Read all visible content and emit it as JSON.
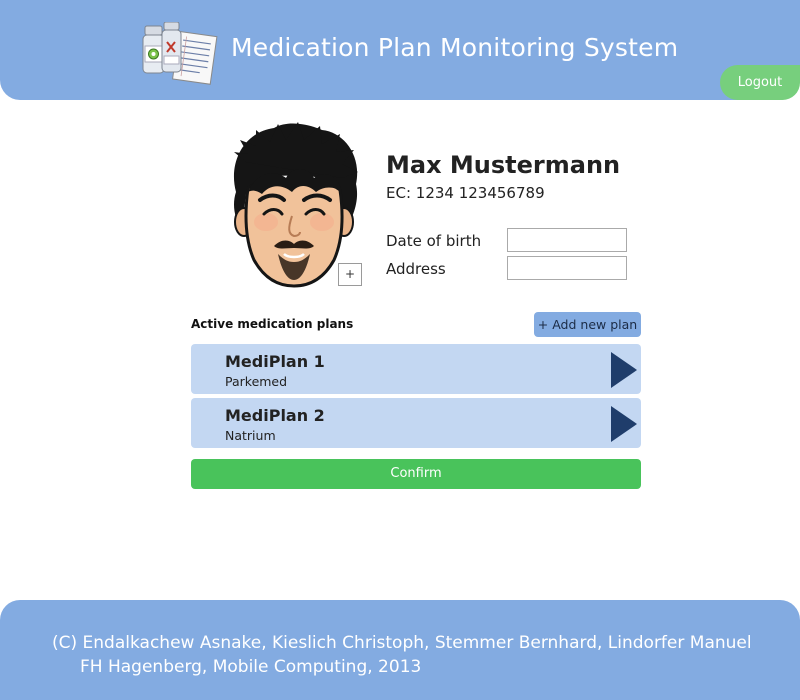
{
  "header": {
    "title": "Medication Plan Monitoring System",
    "logout_label": "Logout",
    "logo_icon": "medication-bottles-document-icon"
  },
  "patient": {
    "name": "Max Mustermann",
    "ec": "EC: 1234 123456789",
    "avatar_icon": "cartoon-face-avatar",
    "add_photo_label": "+",
    "fields": {
      "dob_label": "Date of birth",
      "dob_value": "",
      "address_label": "Address",
      "address_value": ""
    }
  },
  "plans": {
    "heading": "Active medication plans",
    "add_label": "+ Add new plan",
    "items": [
      {
        "name": "MediPlan 1",
        "subtitle": "Parkemed"
      },
      {
        "name": "MediPlan 2",
        "subtitle": "Natrium"
      }
    ],
    "arrow_icon": "play-arrow-icon"
  },
  "actions": {
    "confirm_label": "Confirm"
  },
  "footer": {
    "line1": "(C) Endalkachew Asnake, Kieslich Christoph, Stemmer Bernhard, Lindorfer Manuel",
    "line2": "FH Hagenberg, Mobile Computing, 2013"
  },
  "colors": {
    "header_bg": "#83abe1",
    "logout_bg": "#77cf7d",
    "plan_bg": "#c3d7f2",
    "arrow": "#1f3d6b",
    "confirm_bg": "#49c35b"
  }
}
